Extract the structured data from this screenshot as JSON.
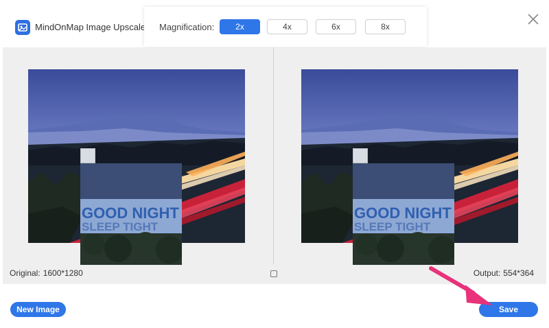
{
  "header": {
    "app_title": "MindOnMap Image Upscaler",
    "logo_icon": "image-icon",
    "magnification_label": "Magnification:",
    "magnification_options": [
      "2x",
      "4x",
      "6x",
      "8x"
    ],
    "magnification_selected": "2x",
    "close_icon": "close-icon"
  },
  "preview": {
    "sign_line1": "GOOD NIGHT",
    "sign_line2": "SLEEP TIGHT"
  },
  "info": {
    "original_label": "Original:",
    "original_value": "1600*1280",
    "output_label": "Output:",
    "output_value": "554*364"
  },
  "footer": {
    "new_image_label": "New Image",
    "save_label": "Save"
  },
  "colors": {
    "accent": "#2f76e8",
    "arrow": "#e8327a"
  }
}
